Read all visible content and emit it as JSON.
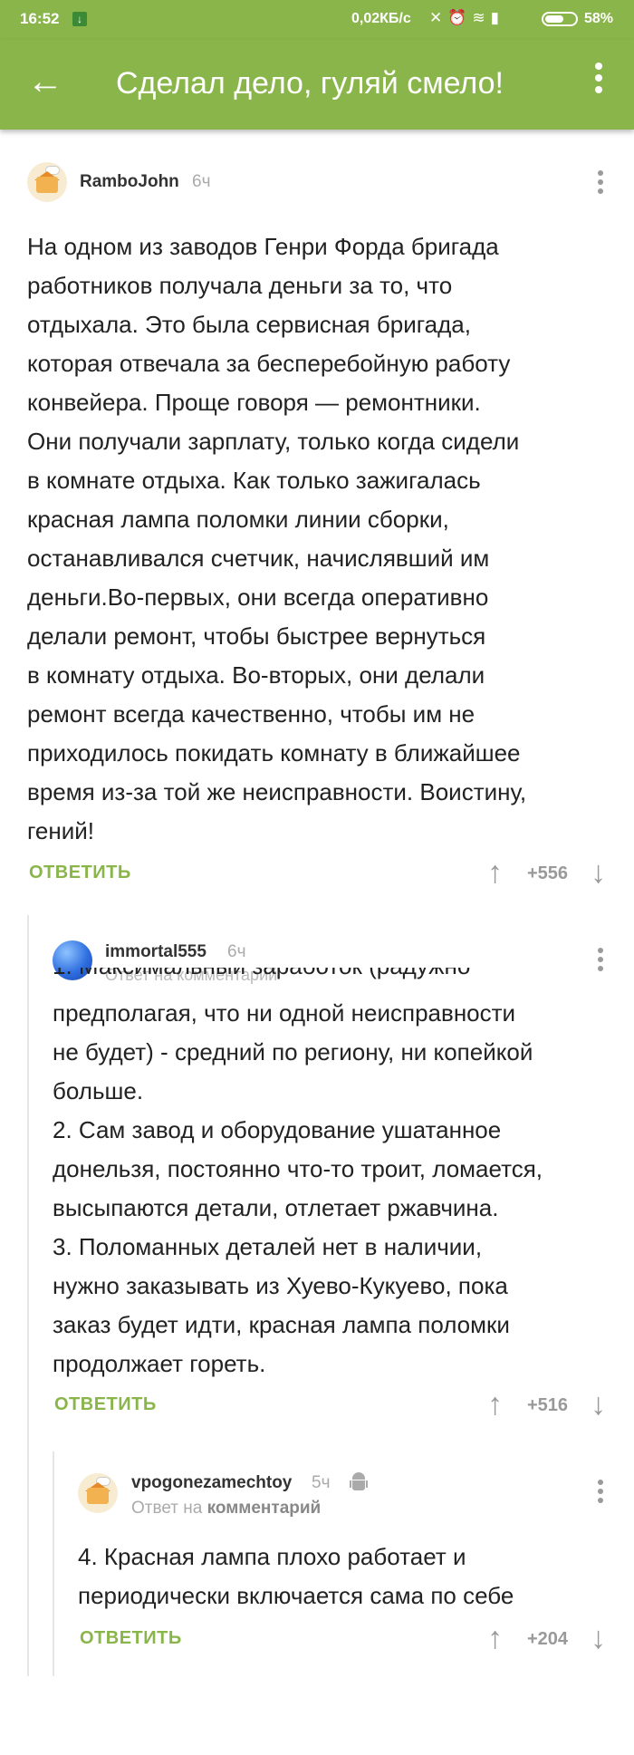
{
  "status_bar": {
    "time": "16:52",
    "speed": "0,02КБ/с",
    "battery": "58%"
  },
  "app_bar": {
    "title": "Сделал дело, гуляй смело!"
  },
  "comments": [
    {
      "username": "RamboJohn",
      "time": "6ч",
      "text": "На одном из заводов Генри Форда бригада\nработников получала деньги за то, что\nотдыхала. Это была сервисная бригада,\nкоторая отвечала за бесперебойную работу\nконвейера. Проще говоря — ремонтники.\nОни получали зарплату, только когда сидели\nв комнате отдыха. Как только зажигалась\nкрасная лампа поломки линии сборки,\nостанавливался счетчик, начислявший им\nденьги.Во-первых, они всегда оперативно\nделали ремонт, чтобы быстрее вернуться\nв комнату отдыха. Во-вторых, они делали\nремонт всегда качественно, чтобы им не\nприходилось покидать комнату в ближайшее\nвремя из-за той же неисправности. Воистину,\nгений!",
      "reply_label": "ОТВЕТИТЬ",
      "score": "+556"
    },
    {
      "username": "immortal555",
      "time": "6ч",
      "ghost_reply": "Ответ на комментарий",
      "first_line_partial": "1. Максимальный заработок (радужно",
      "text": "предполагая, что ни одной неисправности\nне будет) - средний по региону, ни копейкой\nбольше.\n2. Сам завод и оборудование ушатанное\nдонельзя, постоянно что-то троит, ломается,\nвысыпаются детали, отлетает ржавчина.\n3. Поломанных деталей нет в наличии,\nнужно заказывать из Хуево-Кукуево, пока\nзаказ будет идти, красная лампа поломки\nпродолжает гореть.",
      "reply_label": "ОТВЕТИТЬ",
      "score": "+516"
    },
    {
      "username": "vpogonezamechtoy",
      "time": "5ч",
      "reply_prefix": "Ответ на",
      "reply_target": "комментарий",
      "text": "4. Красная лампа плохо работает и\nпериодически включается сама по себе",
      "reply_label": "ОТВЕТИТЬ",
      "score": "+204"
    }
  ]
}
